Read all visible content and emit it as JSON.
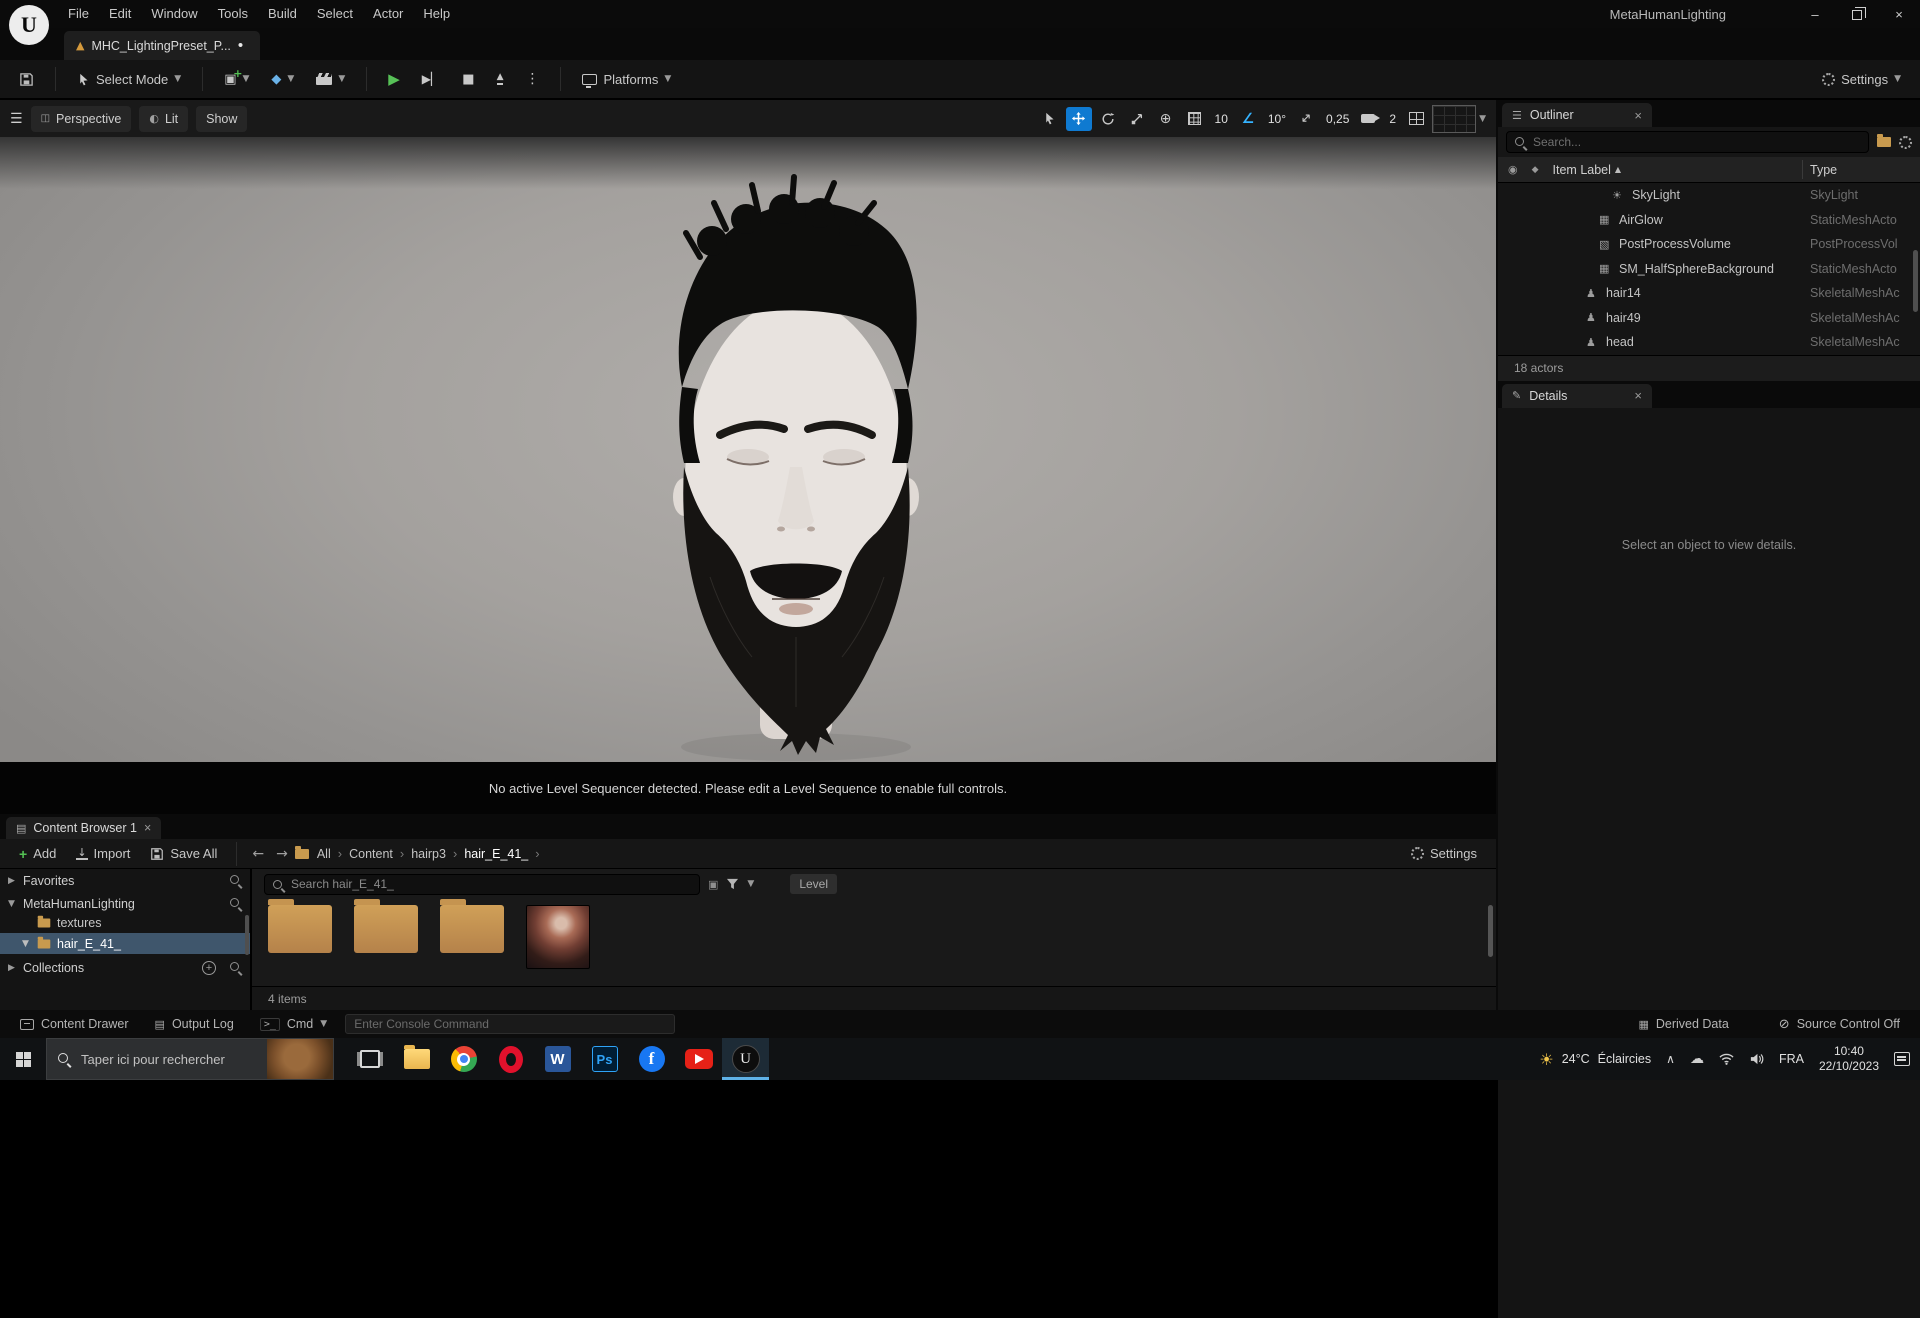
{
  "window": {
    "title": "MetaHumanLighting",
    "menus": [
      "File",
      "Edit",
      "Window",
      "Tools",
      "Build",
      "Select",
      "Actor",
      "Help"
    ]
  },
  "asset_tab": {
    "label": "MHC_LightingPreset_P...",
    "modified": "•"
  },
  "main_toolbar": {
    "select_mode": "Select Mode",
    "platforms": "Platforms",
    "settings": "Settings"
  },
  "viewport": {
    "buttons": {
      "perspective": "Perspective",
      "lit": "Lit",
      "show": "Show"
    },
    "snaps": {
      "grid": "10",
      "rotation": "10°",
      "scale": "0,25",
      "camera_speed": "2"
    },
    "sequencer_notice": "No active Level Sequencer detected. Please edit a Level Sequence to enable full controls."
  },
  "outliner": {
    "title": "Outliner",
    "search_placeholder": "Search...",
    "columns": {
      "label": "Item Label",
      "type": "Type"
    },
    "rows": [
      {
        "label": "SkyLight",
        "type": "SkyLight",
        "icon": "skylight-icon",
        "indent": 2
      },
      {
        "label": "AirGlow",
        "type": "StaticMeshActo",
        "icon": "static-mesh-icon",
        "indent": 1
      },
      {
        "label": "PostProcessVolume",
        "type": "PostProcessVol",
        "icon": "post-process-icon",
        "indent": 1
      },
      {
        "label": "SM_HalfSphereBackground",
        "type": "StaticMeshActo",
        "icon": "static-mesh-icon",
        "indent": 1
      },
      {
        "label": "hair14",
        "type": "SkeletalMeshAc",
        "icon": "skeletal-mesh-icon",
        "indent": 0
      },
      {
        "label": "hair49",
        "type": "SkeletalMeshAc",
        "icon": "skeletal-mesh-icon",
        "indent": 0
      },
      {
        "label": "head",
        "type": "SkeletalMeshAc",
        "icon": "skeletal-mesh-icon",
        "indent": 0
      }
    ],
    "footer": "18 actors"
  },
  "details": {
    "title": "Details",
    "empty_message": "Select an object to view details."
  },
  "content_browser": {
    "tab": "Content Browser 1",
    "toolbar": {
      "add": "Add",
      "import": "Import",
      "save_all": "Save All",
      "settings": "Settings"
    },
    "breadcrumbs": [
      "All",
      "Content",
      "hairp3",
      "hair_E_41_"
    ],
    "sidebar": {
      "favorites": "Favorites",
      "project": "MetaHumanLighting",
      "tree": [
        {
          "label": "textures",
          "selected": false,
          "expanded": false
        },
        {
          "label": "hair_E_41_",
          "selected": true,
          "expanded": true
        }
      ],
      "collections": "Collections"
    },
    "search_placeholder": "Search hair_E_41_",
    "filter_chip": "Level",
    "items": [
      {
        "kind": "folder"
      },
      {
        "kind": "folder"
      },
      {
        "kind": "folder"
      },
      {
        "kind": "asset"
      }
    ],
    "status": "4 items"
  },
  "status_bar": {
    "content_drawer": "Content Drawer",
    "output_log": "Output Log",
    "cmd": "Cmd",
    "console_placeholder": "Enter Console Command",
    "derived_data": "Derived Data",
    "source_control": "Source Control Off"
  },
  "taskbar": {
    "search_placeholder": "Taper ici pour rechercher",
    "apps": [
      "task-view",
      "file-explorer",
      "chrome",
      "opera",
      "word",
      "photoshop",
      "facebook",
      "youtube",
      "unreal-engine"
    ],
    "weather": {
      "temp": "24°C",
      "condition": "Éclaircies"
    },
    "language": "FRA",
    "clock": {
      "time": "10:40",
      "date": "22/10/2023"
    }
  }
}
